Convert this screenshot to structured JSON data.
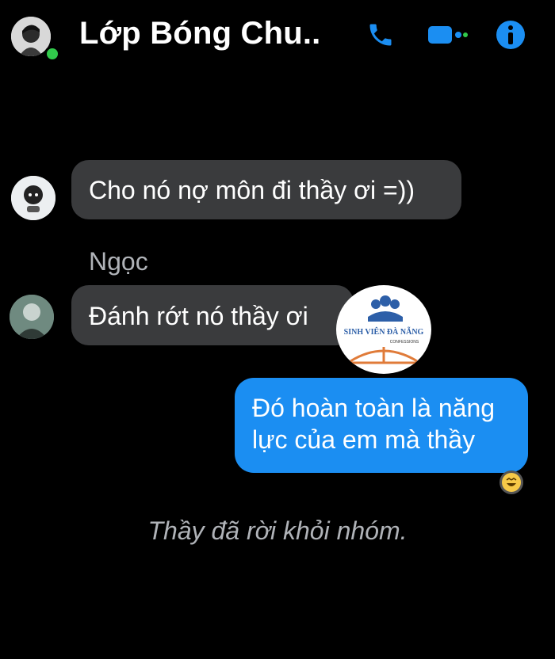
{
  "header": {
    "title": "Lớp Bóng Chu..",
    "icons": {
      "call": "phone-icon",
      "video": "video-camera-icon",
      "info": "info-icon"
    },
    "accent_color": "#1b8ef2",
    "online_color": "#31c94b"
  },
  "messages": [
    {
      "sender": "",
      "text": "Cho nó nợ môn đi thầy ơi =))",
      "side": "left"
    },
    {
      "sender": "Ngọc",
      "text": "Đánh rớt nó thầy ơi",
      "side": "left"
    },
    {
      "sender": "",
      "text_lines": [
        "Đó hoàn toàn là năng",
        "lực của em mà thầy"
      ],
      "side": "right"
    }
  ],
  "seen_indicator": "laughing-emoji-icon",
  "system_message": "Thầy đã rời khỏi nhóm.",
  "watermark": {
    "line1": "SINH VIÊN ĐÀ NẴNG",
    "line2": "CONFESSIONS"
  },
  "colors": {
    "bubble_gray": "#3a3b3d",
    "bubble_blue": "#1b8ef2",
    "background": "#000000",
    "muted_text": "#b0b3b8"
  }
}
